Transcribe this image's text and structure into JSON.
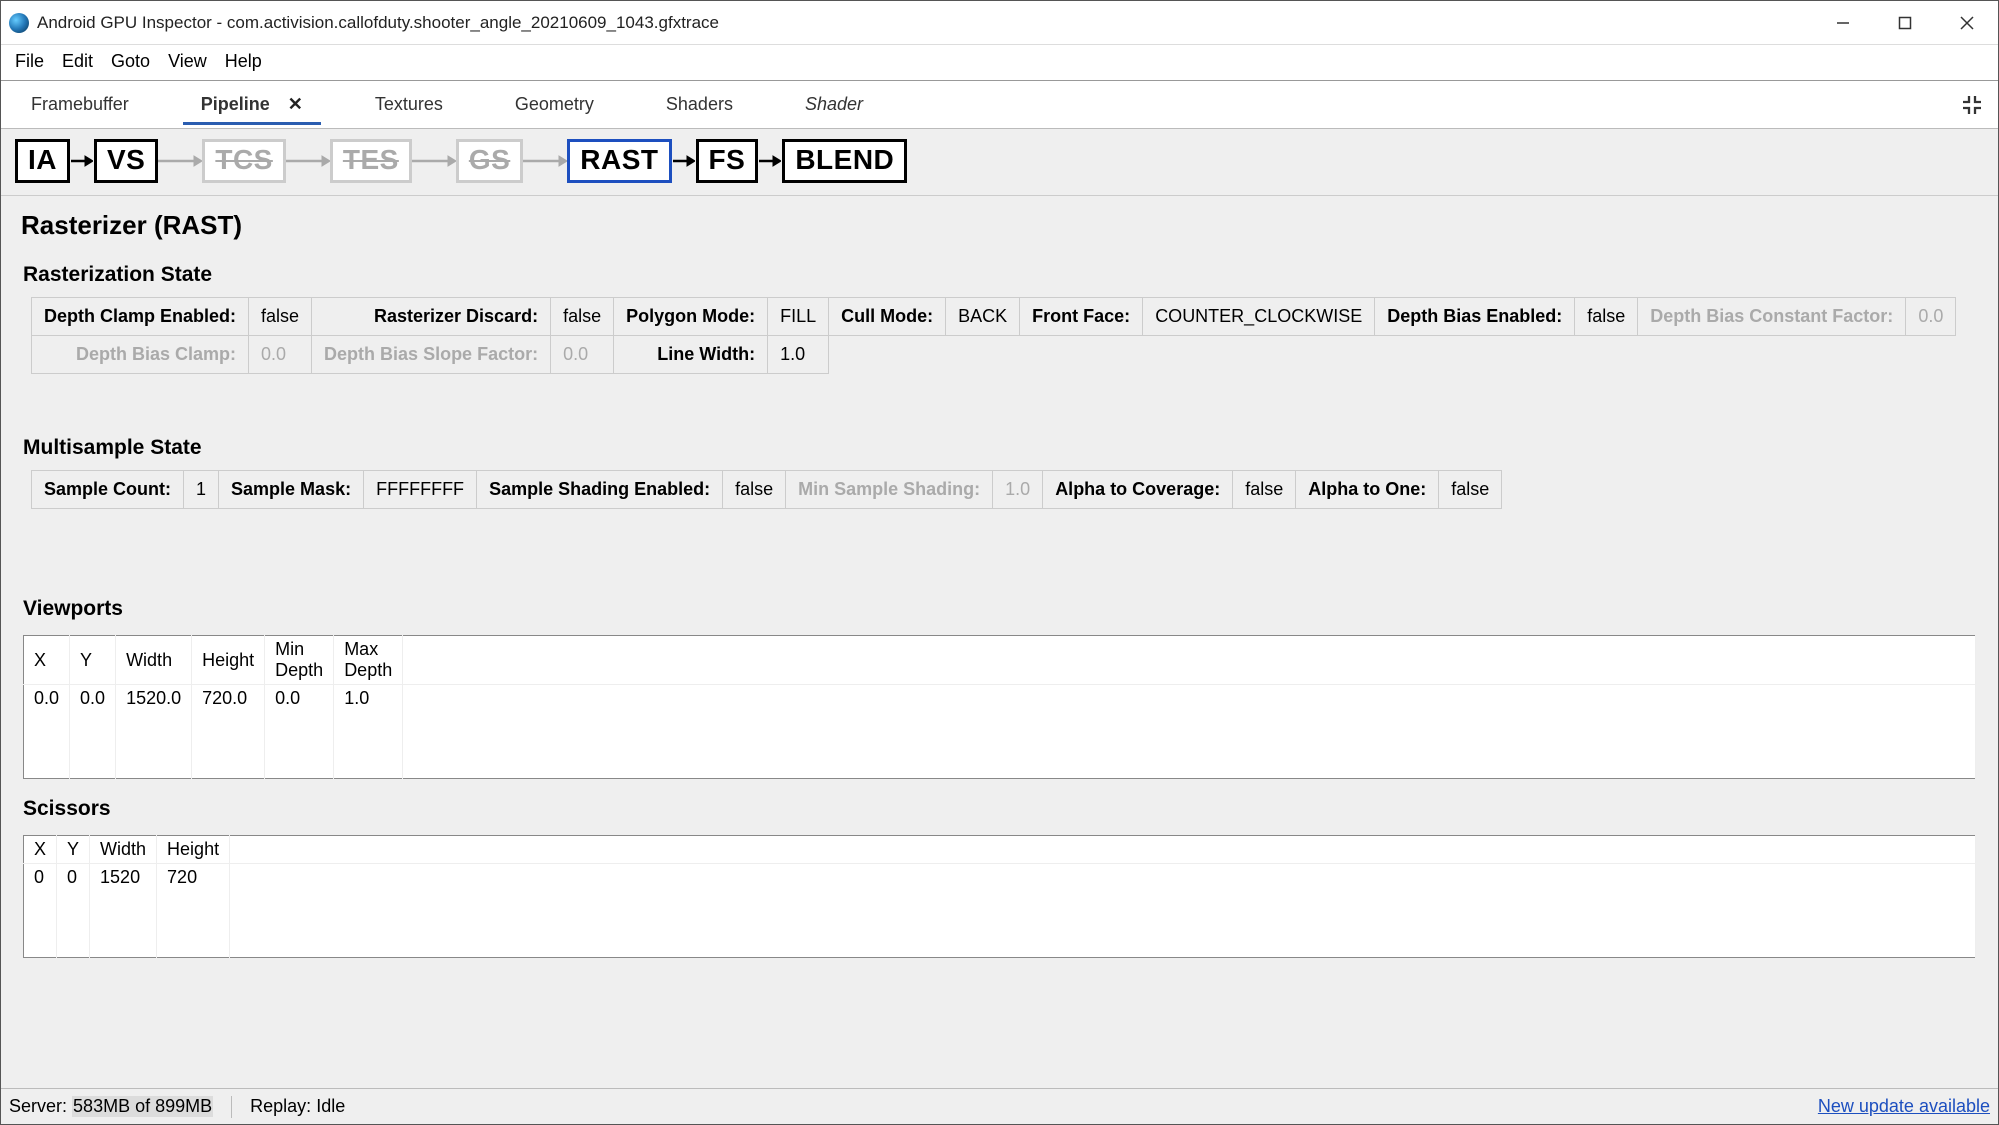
{
  "window": {
    "title": "Android GPU Inspector - com.activision.callofduty.shooter_angle_20210609_1043.gfxtrace"
  },
  "menu": {
    "items": [
      "File",
      "Edit",
      "Goto",
      "View",
      "Help"
    ]
  },
  "tabs": [
    {
      "label": "Framebuffer",
      "active": false,
      "closable": false,
      "italic": false
    },
    {
      "label": "Pipeline",
      "active": true,
      "closable": true,
      "italic": false
    },
    {
      "label": "Textures",
      "active": false,
      "closable": false,
      "italic": false
    },
    {
      "label": "Geometry",
      "active": false,
      "closable": false,
      "italic": false
    },
    {
      "label": "Shaders",
      "active": false,
      "closable": false,
      "italic": false
    },
    {
      "label": "Shader",
      "active": false,
      "closable": false,
      "italic": true
    }
  ],
  "pipeline": {
    "stages": [
      {
        "code": "IA",
        "disabled": false,
        "selected": false
      },
      {
        "code": "VS",
        "disabled": false,
        "selected": false
      },
      {
        "code": "TCS",
        "disabled": true,
        "selected": false
      },
      {
        "code": "TES",
        "disabled": true,
        "selected": false
      },
      {
        "code": "GS",
        "disabled": true,
        "selected": false
      },
      {
        "code": "RAST",
        "disabled": false,
        "selected": true
      },
      {
        "code": "FS",
        "disabled": false,
        "selected": false
      },
      {
        "code": "BLEND",
        "disabled": false,
        "selected": false
      }
    ]
  },
  "page": {
    "title": "Rasterizer (RAST)"
  },
  "sections": {
    "raster": {
      "title": "Rasterization State",
      "row1": [
        {
          "label": "Depth Clamp Enabled:",
          "value": "false",
          "dim": false
        },
        {
          "label": "Rasterizer Discard:",
          "value": "false",
          "dim": false
        },
        {
          "label": "Polygon Mode:",
          "value": "FILL",
          "dim": false
        },
        {
          "label": "Cull Mode:",
          "value": "BACK",
          "dim": false
        },
        {
          "label": "Front Face:",
          "value": "COUNTER_CLOCKWISE",
          "dim": false
        },
        {
          "label": "Depth Bias Enabled:",
          "value": "false",
          "dim": false
        },
        {
          "label": "Depth Bias Constant Factor:",
          "value": "0.0",
          "dim": true
        }
      ],
      "row2": [
        {
          "label": "Depth Bias Clamp:",
          "value": "0.0",
          "dim": true
        },
        {
          "label": "Depth Bias Slope Factor:",
          "value": "0.0",
          "dim": true
        },
        {
          "label": "Line Width:",
          "value": "1.0",
          "dim": false
        }
      ]
    },
    "multisample": {
      "title": "Multisample State",
      "row1": [
        {
          "label": "Sample Count:",
          "value": "1",
          "dim": false
        },
        {
          "label": "Sample Mask:",
          "value": "FFFFFFFF",
          "dim": false
        },
        {
          "label": "Sample Shading Enabled:",
          "value": "false",
          "dim": false
        },
        {
          "label": "Min Sample Shading:",
          "value": "1.0",
          "dim": true
        },
        {
          "label": "Alpha to Coverage:",
          "value": "false",
          "dim": false
        },
        {
          "label": "Alpha to One:",
          "value": "false",
          "dim": false
        }
      ]
    },
    "viewports": {
      "title": "Viewports",
      "headers": [
        "X",
        "Y",
        "Width",
        "Height",
        "Min Depth",
        "Max Depth"
      ],
      "rows": [
        [
          "0.0",
          "0.0",
          "1520.0",
          "720.0",
          "0.0",
          "1.0"
        ]
      ]
    },
    "scissors": {
      "title": "Scissors",
      "headers": [
        "X",
        "Y",
        "Width",
        "Height"
      ],
      "rows": [
        [
          "0",
          "0",
          "1520",
          "720"
        ]
      ]
    }
  },
  "status": {
    "server_label": "Server:",
    "server_mem_used": "583MB",
    "server_mem_mid": " of ",
    "server_mem_total": "899MB",
    "replay_label": "Replay:",
    "replay_value": "Idle",
    "update_link": "New update available"
  }
}
